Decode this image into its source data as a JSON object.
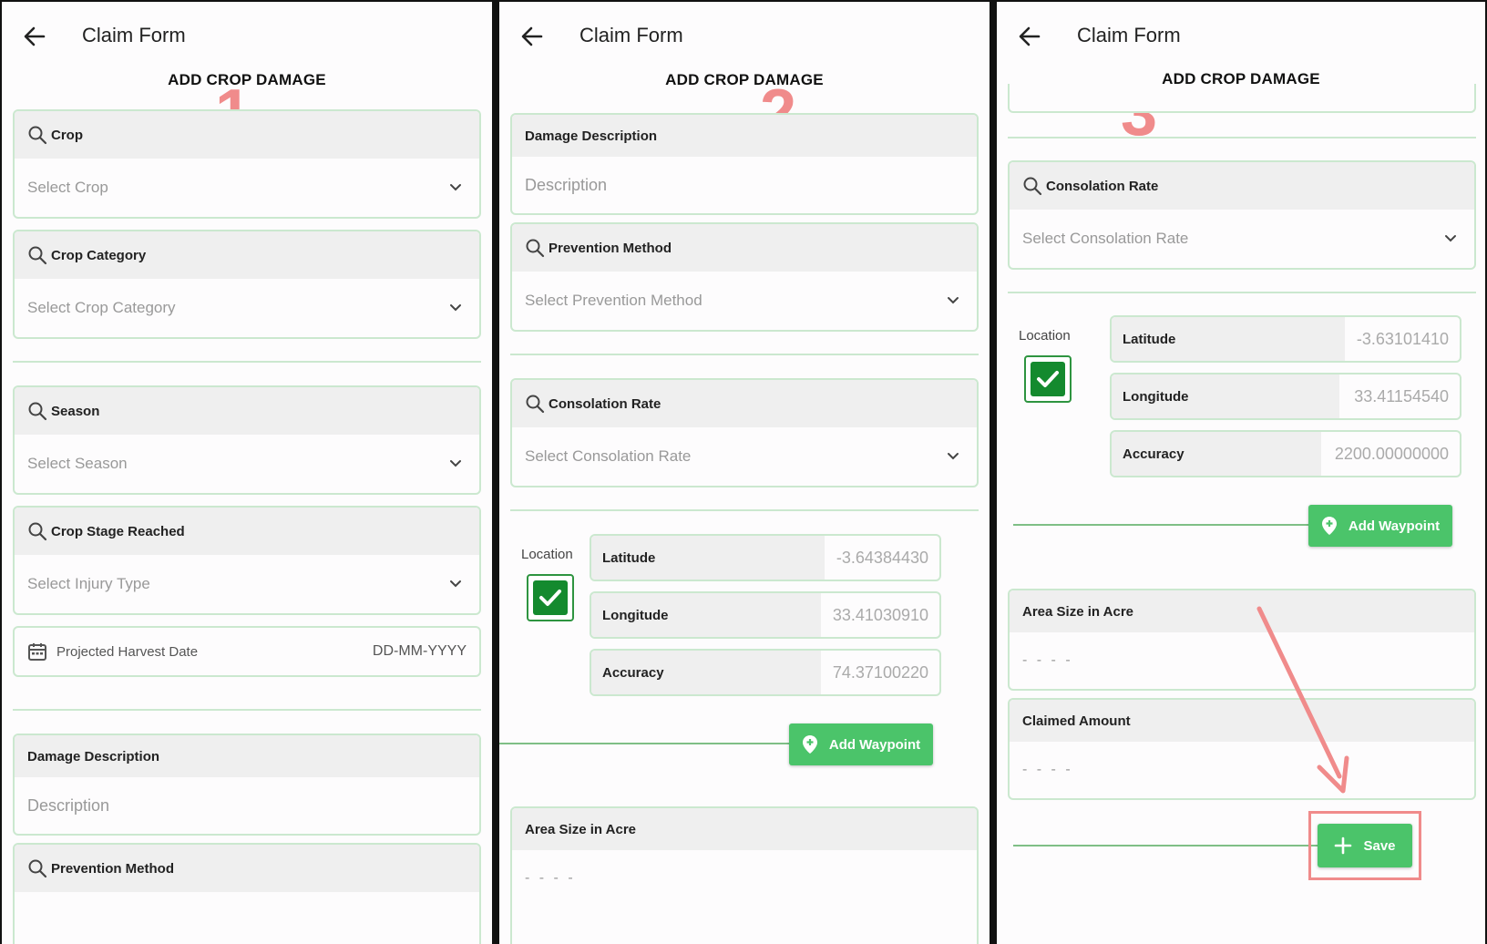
{
  "app": {
    "title": "Claim Form",
    "heading": "ADD CROP DAMAGE"
  },
  "steps": [
    "1",
    "2",
    "3"
  ],
  "panel1": {
    "crop": {
      "label": "Crop",
      "placeholder": "Select Crop"
    },
    "crop_category": {
      "label": "Crop Category",
      "placeholder": "Select Crop Category"
    },
    "season": {
      "label": "Season",
      "placeholder": "Select Season"
    },
    "crop_stage": {
      "label": "Crop Stage Reached",
      "placeholder": "Select Injury Type"
    },
    "harvest_date": {
      "label": "Projected Harvest Date",
      "value": "DD-MM-YYYY"
    },
    "damage_description": {
      "label": "Damage Description",
      "placeholder": "Description"
    },
    "prevention_method": {
      "label": "Prevention Method"
    }
  },
  "panel2": {
    "damage_description": {
      "label": "Damage Description",
      "placeholder": "Description"
    },
    "prevention_method": {
      "label": "Prevention Method",
      "placeholder": "Select Prevention Method"
    },
    "consolation_rate": {
      "label": "Consolation Rate",
      "placeholder": "Select Consolation Rate"
    },
    "location": {
      "label": "Location",
      "checked": true,
      "latitude": {
        "label": "Latitude",
        "value": "-3.64384430"
      },
      "longitude": {
        "label": "Longitude",
        "value": "33.41030910"
      },
      "accuracy": {
        "label": "Accuracy",
        "value": "74.37100220"
      }
    },
    "add_waypoint": "Add Waypoint",
    "area_size": {
      "label": "Area Size in Acre",
      "value": "- - - -"
    }
  },
  "panel3": {
    "consolation_rate": {
      "label": "Consolation Rate",
      "placeholder": "Select Consolation Rate"
    },
    "location": {
      "label": "Location",
      "checked": true,
      "latitude": {
        "label": "Latitude",
        "value": "-3.63101410"
      },
      "longitude": {
        "label": "Longitude",
        "value": "33.41154540"
      },
      "accuracy": {
        "label": "Accuracy",
        "value": "2200.00000000"
      }
    },
    "add_waypoint": "Add Waypoint",
    "area_size": {
      "label": "Area Size in Acre",
      "value": "- - - -"
    },
    "claimed_amount": {
      "label": "Claimed Amount",
      "value": "- - - -"
    },
    "save": "Save"
  },
  "colors": {
    "accent_green": "#4bc46a",
    "border_green": "#cbe8cf",
    "checkbox_green": "#148a2e",
    "annotation_pink": "#f08b8b"
  },
  "icons": [
    "back-arrow-icon",
    "search-icon",
    "chevron-down-icon",
    "calendar-icon",
    "checkmark-icon",
    "map-pin-icon",
    "plus-icon"
  ]
}
